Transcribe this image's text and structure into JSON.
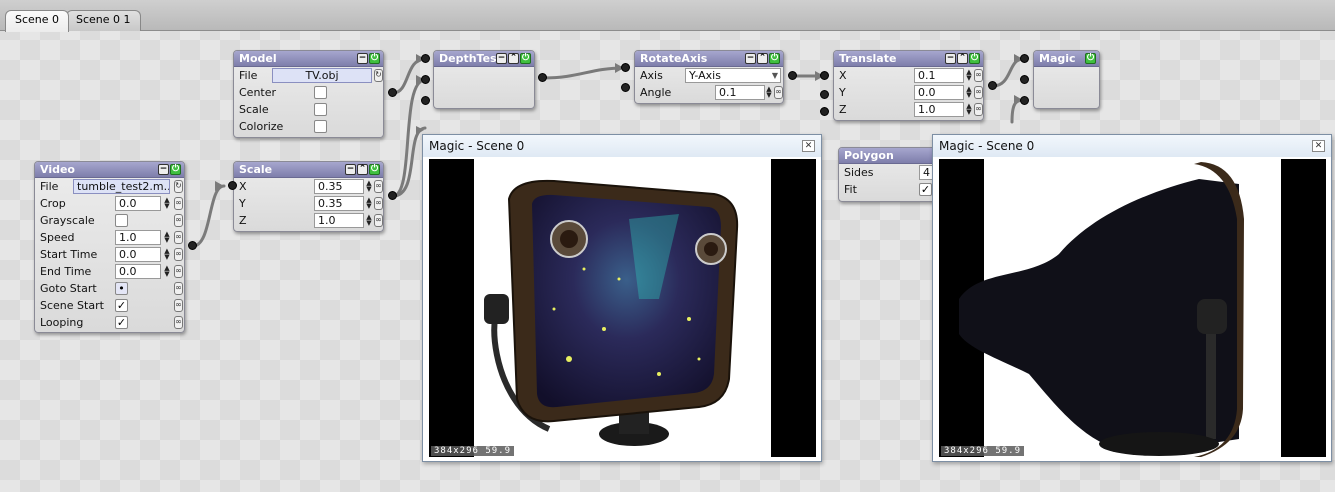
{
  "tabs": [
    {
      "label": "Scene 0"
    },
    {
      "label": "Scene 0 1"
    }
  ],
  "nodes": {
    "video": {
      "title": "Video",
      "rows": {
        "file": {
          "label": "File",
          "value": "tumble_test2.m..."
        },
        "crop": {
          "label": "Crop",
          "value": "0.0"
        },
        "grayscale": {
          "label": "Grayscale",
          "checked": false
        },
        "speed": {
          "label": "Speed",
          "value": "1.0"
        },
        "start_time": {
          "label": "Start Time",
          "value": "0.0"
        },
        "end_time": {
          "label": "End Time",
          "value": "0.0"
        },
        "goto_start": {
          "label": "Goto Start",
          "value": "•"
        },
        "scene_start": {
          "label": "Scene Start",
          "checked": true
        },
        "looping": {
          "label": "Looping",
          "checked": true
        }
      }
    },
    "model": {
      "title": "Model",
      "rows": {
        "file": {
          "label": "File",
          "value": "TV.obj"
        },
        "center": {
          "label": "Center",
          "checked": false
        },
        "scale": {
          "label": "Scale",
          "checked": false
        },
        "colorize": {
          "label": "Colorize",
          "checked": false
        }
      }
    },
    "scale": {
      "title": "Scale",
      "rows": {
        "x": {
          "label": "X",
          "value": "0.35"
        },
        "y": {
          "label": "Y",
          "value": "0.35"
        },
        "z": {
          "label": "Z",
          "value": "1.0"
        }
      }
    },
    "depthtest": {
      "title": "DepthTest"
    },
    "rotateaxis": {
      "title": "RotateAxis",
      "rows": {
        "axis": {
          "label": "Axis",
          "value": "Y-Axis"
        },
        "angle": {
          "label": "Angle",
          "value": "0.1"
        }
      }
    },
    "translate": {
      "title": "Translate",
      "rows": {
        "x": {
          "label": "X",
          "value": "0.1"
        },
        "y": {
          "label": "Y",
          "value": "0.0"
        },
        "z": {
          "label": "Z",
          "value": "1.0"
        }
      }
    },
    "magic": {
      "title": "Magic"
    },
    "polygon": {
      "title": "Polygon",
      "rows": {
        "sides": {
          "label": "Sides",
          "value": "4"
        },
        "fit": {
          "label": "Fit",
          "checked": true
        }
      }
    }
  },
  "windows": [
    {
      "title": "Magic - Scene 0",
      "status": "384x296 59.9"
    },
    {
      "title": "Magic - Scene 0",
      "status": "384x296 59.9"
    }
  ],
  "icons": {
    "minimize": "minimize-icon",
    "collapse": "collapse-icon",
    "enable": "enable-icon",
    "link": "link-icon",
    "close": "close-icon",
    "reload": "reload-icon"
  },
  "colors": {
    "node_header": "#8c8cb8",
    "wire": "#7a7a7a",
    "tv_frame": "#3b2a1a",
    "screen": "#2a2550"
  }
}
